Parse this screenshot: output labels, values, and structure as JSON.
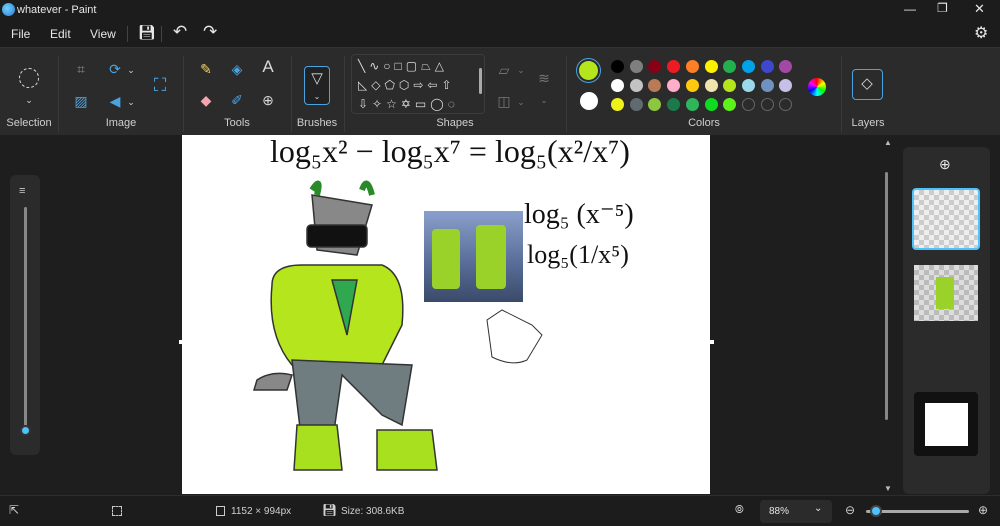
{
  "window": {
    "title": "whatever - Paint",
    "controls": [
      "minimize",
      "maximize",
      "close"
    ]
  },
  "menu": {
    "file": "File",
    "edit": "Edit",
    "view": "View"
  },
  "ribbon": {
    "groups": {
      "selection": "Selection",
      "image": "Image",
      "tools": "Tools",
      "brushes": "Brushes",
      "shapes": "Shapes",
      "colors": "Colors",
      "layers": "Layers"
    },
    "primary_color": "#b5e61d",
    "secondary_color": "#ffffff",
    "palette": [
      [
        "#000000",
        "#7f7f7f",
        "#880015",
        "#ed1c24",
        "#ff7f27",
        "#fff200",
        "#22b14c",
        "#00a2e8",
        "#3f48cc",
        "#a349a4"
      ],
      [
        "#ffffff",
        "#c3c3c3",
        "#b97a57",
        "#ffaec9",
        "#ffc90e",
        "#efe4b0",
        "#b5e61d",
        "#99d9ea",
        "#7092be",
        "#c8bfe7"
      ],
      [
        "#eef21a",
        "#5f6b70",
        "#8dc63f",
        "#1a7a4a",
        "#2fb55a",
        "#0fdc1f",
        "#5cf21a",
        "",
        "",
        ""
      ]
    ]
  },
  "canvas": {
    "eq1": "log₅x² − log₅x⁷ = log₅(x²/x⁷)",
    "eq2": "log₅ (x⁻⁵)",
    "eq3": "log₅(1/x⁵)"
  },
  "zoom_slider_value": 0.05,
  "status": {
    "dimensions": "1152 × 994px",
    "size": "Size: 308.6KB",
    "zoom": "88%",
    "zoom_fraction": 0.1
  }
}
